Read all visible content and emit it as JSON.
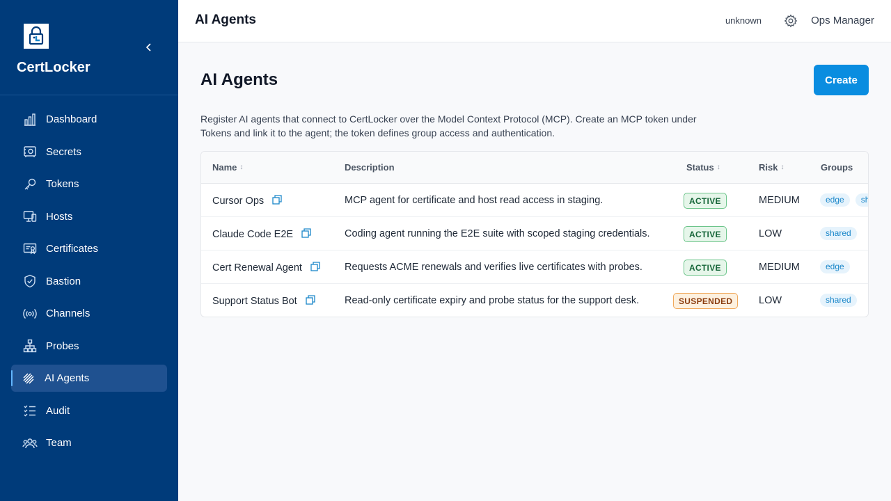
{
  "sidebar": {
    "brand": "CertLocker",
    "items": [
      {
        "label": "Dashboard",
        "icon": "bar-chart-icon"
      },
      {
        "label": "Secrets",
        "icon": "vault-icon"
      },
      {
        "label": "Tokens",
        "icon": "key-icon"
      },
      {
        "label": "Hosts",
        "icon": "devices-icon"
      },
      {
        "label": "Certificates",
        "icon": "certificate-icon"
      },
      {
        "label": "Bastion",
        "icon": "shield-icon"
      },
      {
        "label": "Channels",
        "icon": "broadcast-icon"
      },
      {
        "label": "Probes",
        "icon": "network-icon"
      },
      {
        "label": "AI Agents",
        "icon": "ai-agent-icon",
        "active": true
      },
      {
        "label": "Audit",
        "icon": "checklist-icon"
      },
      {
        "label": "Team",
        "icon": "team-icon"
      }
    ]
  },
  "topbar": {
    "title": "AI Agents",
    "user": "unknown",
    "role": "Ops Manager"
  },
  "main": {
    "title": "AI Agents",
    "create_label": "Create",
    "description": "Register AI agents that connect to CertLocker over the Model Context Protocol (MCP). Create an MCP token under Tokens and link it to the agent; the token defines group access and authentication.",
    "columns": {
      "name": "Name",
      "description": "Description",
      "status": "Status",
      "risk": "Risk",
      "groups": "Groups"
    },
    "rows": [
      {
        "name": "Cursor Ops",
        "description": "MCP agent for certificate and host read access in staging.",
        "status": "ACTIVE",
        "risk": "MEDIUM",
        "groups": [
          "edge",
          "sh"
        ]
      },
      {
        "name": "Claude Code E2E",
        "description": "Coding agent running the E2E suite with scoped staging credentials.",
        "status": "ACTIVE",
        "risk": "LOW",
        "groups": [
          "shared"
        ]
      },
      {
        "name": "Cert Renewal Agent",
        "description": "Requests ACME renewals and verifies live certificates with probes.",
        "status": "ACTIVE",
        "risk": "MEDIUM",
        "groups": [
          "edge"
        ]
      },
      {
        "name": "Support Status Bot",
        "description": "Read-only certificate expiry and probe status for the support desk.",
        "status": "SUSPENDED",
        "risk": "LOW",
        "groups": [
          "shared"
        ]
      }
    ]
  },
  "colors": {
    "sidebar_bg": "#003b7a",
    "accent": "#0a8de0",
    "active_badge": "#17663a",
    "suspended_badge": "#8a3c0e"
  }
}
